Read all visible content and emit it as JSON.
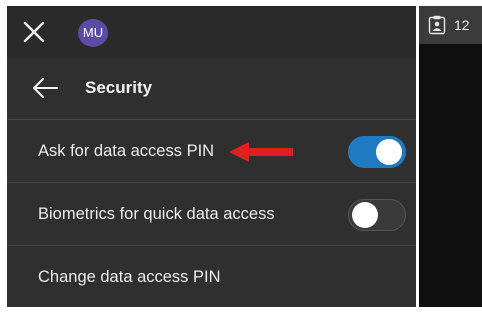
{
  "header": {
    "close_icon": "close-icon",
    "avatar_initials": "MU"
  },
  "title_bar": {
    "back_icon": "arrow-left-icon",
    "title": "Security"
  },
  "settings": [
    {
      "label": "Ask for data access PIN",
      "toggle": "on"
    },
    {
      "label": "Biometrics for quick data access",
      "toggle": "off"
    },
    {
      "label": "Change data access PIN"
    }
  ],
  "annotation": {
    "icon": "red-arrow-icon",
    "color": "#e02020"
  },
  "side_panel": {
    "icon": "clipboard-user-icon",
    "count": "12"
  },
  "colors": {
    "panel_bg": "#2f2f2f",
    "toggle_on": "#1f7ac2",
    "avatar_bg": "#5b4aa6"
  }
}
